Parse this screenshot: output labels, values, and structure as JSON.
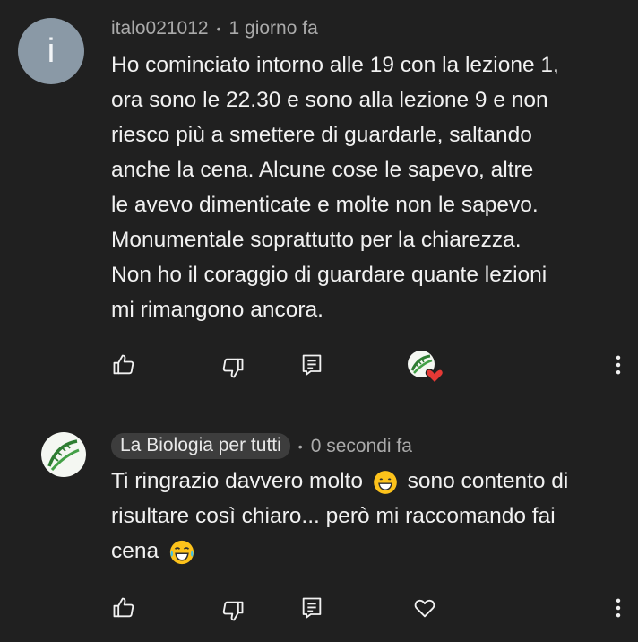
{
  "comment1": {
    "avatar_letter": "i",
    "author": "italo021012",
    "time": "1 giorno fa",
    "text": "Ho cominciato intorno alle 19 con la lezione 1,\nora sono le 22.30 e sono alla lezione 9 e non\nriesco più a smettere di guardarle, saltando\nanche la cena. Alcune cose le sapevo, altre\nle avevo dimenticate e molte non le sapevo.\nMonumentale soprattutto per la chiarezza.\nNon ho il coraggio di guardare quante lezioni\nmi rimangono ancora."
  },
  "comment2": {
    "author": "La Biologia per tutti",
    "time": "0 secondi fa",
    "text_line1": "Ti ringrazio davvero molto",
    "text_line1_rest": "sono contento di",
    "text_line2": "risultare così chiaro... però mi raccomando fai",
    "text_line3": "cena"
  },
  "colors": {
    "background": "#202020",
    "text": "#f1f1f1",
    "meta": "#aaaaaa",
    "heart": "#e53935",
    "logo_green": "#2e7d32"
  },
  "icons": [
    "like-icon",
    "dislike-icon",
    "reply-icon",
    "heart-icon",
    "more-icon"
  ]
}
